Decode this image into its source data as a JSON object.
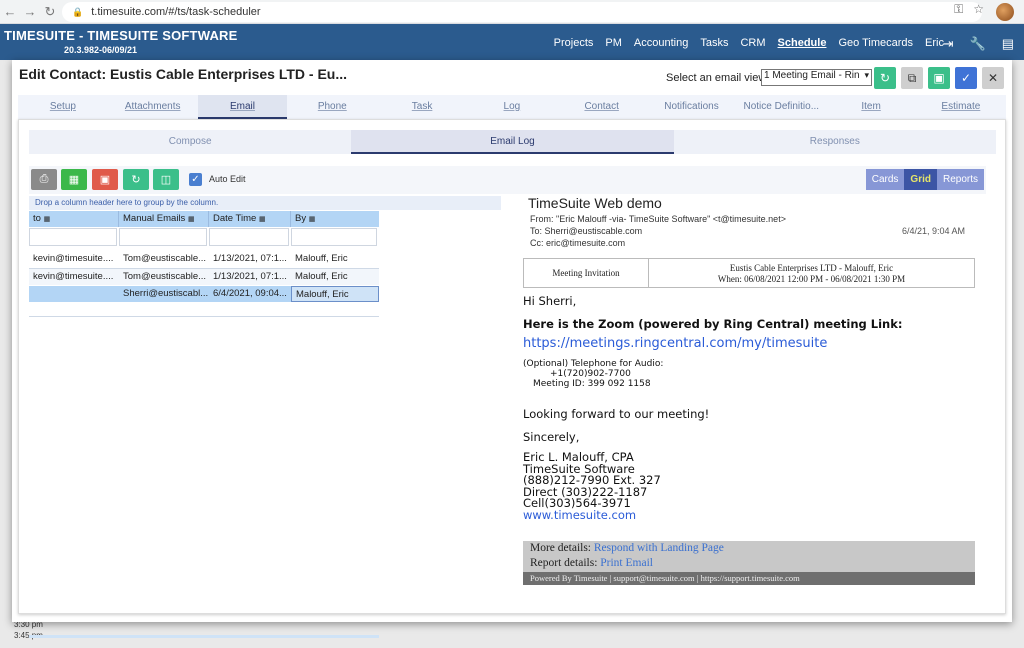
{
  "browser": {
    "back_icon": "←",
    "forward_icon": "→",
    "reload_icon": "C",
    "url": "t.timesuite.com/#/ts/task-scheduler"
  },
  "app": {
    "title": "TIMESUITE - TIMESUITE SOFTWARE",
    "version": "20.3.982-06/09/21",
    "nav": [
      "Projects",
      "PM",
      "Accounting",
      "Tasks",
      "CRM",
      "Schedule",
      "Geo Timecards",
      "Eric"
    ],
    "active_nav": "Schedule"
  },
  "background": {
    "times": [
      "3:30 pm",
      "3:45 pm"
    ]
  },
  "modal": {
    "title": "Edit Contact: Eustis Cable Enterprises LTD - Eu...",
    "email_view_label": "Select an email view:",
    "email_view_value": "1 Meeting Email - Rin",
    "buttons": {
      "refresh_color": "#3bbf8a",
      "copy_color": "#cfcfcf",
      "save_color": "#3bbf8a",
      "confirm_color": "#3f73d6",
      "close_color": "#cfcfcf"
    }
  },
  "tabs": [
    {
      "label": "Setup",
      "active": false
    },
    {
      "label": "Attachments",
      "active": false
    },
    {
      "label": "Email",
      "active": true
    },
    {
      "label": "Phone",
      "active": false
    },
    {
      "label": "Task",
      "active": false
    },
    {
      "label": "Log",
      "active": false
    },
    {
      "label": "Contact",
      "active": false
    },
    {
      "label": "Notifications",
      "active": false
    },
    {
      "label": "Notice Definitio...",
      "active": false
    },
    {
      "label": "Item",
      "active": false
    },
    {
      "label": "Estimate",
      "active": false
    }
  ],
  "subtabs": [
    {
      "label": "Compose",
      "active": false
    },
    {
      "label": "Email Log",
      "active": true
    },
    {
      "label": "Responses",
      "active": false
    }
  ],
  "toolbar": {
    "auto_edit_label": "Auto Edit",
    "auto_edit_checked": true,
    "view_buttons": [
      {
        "label": "Cards",
        "active": false
      },
      {
        "label": "Grid",
        "active": true
      },
      {
        "label": "Reports",
        "active": false
      }
    ]
  },
  "grid": {
    "group_hint": "Drop a column header here to group by the column.",
    "columns": [
      "to",
      "Manual Emails",
      "Date Time",
      "By"
    ],
    "rows": [
      {
        "to": "kevin@timesuite....",
        "manual": "Tom@eustiscable...",
        "datetime": "1/13/2021, 07:1...",
        "by": "Malouff, Eric"
      },
      {
        "to": "kevin@timesuite....",
        "manual": "Tom@eustiscable...",
        "datetime": "1/13/2021, 07:1...",
        "by": "Malouff, Eric"
      },
      {
        "to": "",
        "manual": "Sherri@eustiscabl...",
        "datetime": "6/4/2021, 09:04...",
        "by": "Malouff, Eric"
      }
    ]
  },
  "email": {
    "subject": "TimeSuite Web demo",
    "from": "From: \"Eric Malouff -via- TimeSuite Software\" <t@timesuite.net>",
    "to": "To: Sherri@eustiscable.com",
    "cc": "Cc: eric@timesuite.com",
    "date": "6/4/21, 9:04 AM",
    "invitation_label": "Meeting Invitation",
    "invitation_title": "Eustis Cable Enterprises LTD - Malouff, Eric",
    "invitation_when": "When: 06/08/2021 12:00 PM - 06/08/2021 1:30 PM",
    "greeting": "Hi Sherri,",
    "headline": "Here is the Zoom (powered by Ring Central) meeting Link:",
    "meeting_link": "https://meetings.ringcentral.com/my/timesuite",
    "phone_label": "(Optional) Telephone for Audio:",
    "phone_number": "+1(720)902-7700",
    "meeting_id": "Meeting ID: 399 092 1158",
    "closing1": "Looking forward to our meeting!",
    "closing2": "Sincerely,",
    "sig_name": "Eric L. Malouff, CPA",
    "sig_company": "TimeSuite Software",
    "sig_phone1": "(888)212-7990 Ext. 327",
    "sig_phone2": "Direct (303)222-1187",
    "sig_phone3": "Cell(303)564-3971",
    "sig_site": "www.timesuite.com",
    "more_details_label": "More details:",
    "more_details_link": "Respond with Landing Page",
    "report_details_label": "Report details:",
    "report_details_link": "Print Email",
    "powered_by": "Powered By Timesuite | support@timesuite.com | https://support.timesuite.com"
  }
}
